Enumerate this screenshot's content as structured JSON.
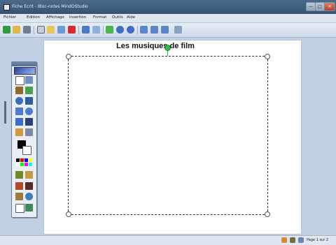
{
  "window": {
    "title": "Fiche Ecrit - Bloc-notes MindOStudio",
    "controls": [
      "—",
      "□",
      "✕"
    ]
  },
  "menubar": {
    "items": [
      "Fichier",
      "Edition",
      "Affichage",
      "Insertion",
      "Format",
      "Outils",
      "Aide"
    ]
  },
  "toolbar": {
    "icons": [
      "open-icon",
      "save-icon",
      "print-icon",
      "cut-icon",
      "copy-icon",
      "paste-icon",
      "delete-icon",
      "undo-icon",
      "redo-icon",
      "new-page-icon",
      "previous-icon",
      "next-icon",
      "zoom-in-icon",
      "zoom-out-icon",
      "zoom-fit-icon",
      "page-settings-icon"
    ]
  },
  "document": {
    "title": "Les musiques de film"
  },
  "palette": {
    "tools": [
      "select-icon",
      "zoom-icon",
      "pen-icon",
      "marker-icon",
      "circle-pen-icon",
      "line-icon",
      "rectangle-icon",
      "ellipse-icon",
      "shape-icon",
      "text-icon",
      "eraser-icon",
      "fill-icon",
      "color-swatch-icon",
      "brush-icon",
      "stamp-icon",
      "picture-icon",
      "cancel-icon",
      "rotate-icon",
      "globe-icon",
      "copy-icon",
      "paste-icon"
    ],
    "colors": [
      "#000000",
      "#ff0000",
      "#0000ff",
      "#ffff00",
      "#ffffff",
      "#00ff00",
      "#ff00ff",
      "#00ffff"
    ]
  },
  "status": {
    "page_label": "Page 1 sur 2"
  },
  "colors": {
    "titlebar": "#3f5d7c",
    "workspace": "#c2d0e3",
    "rotation_handle": "#29c140"
  }
}
